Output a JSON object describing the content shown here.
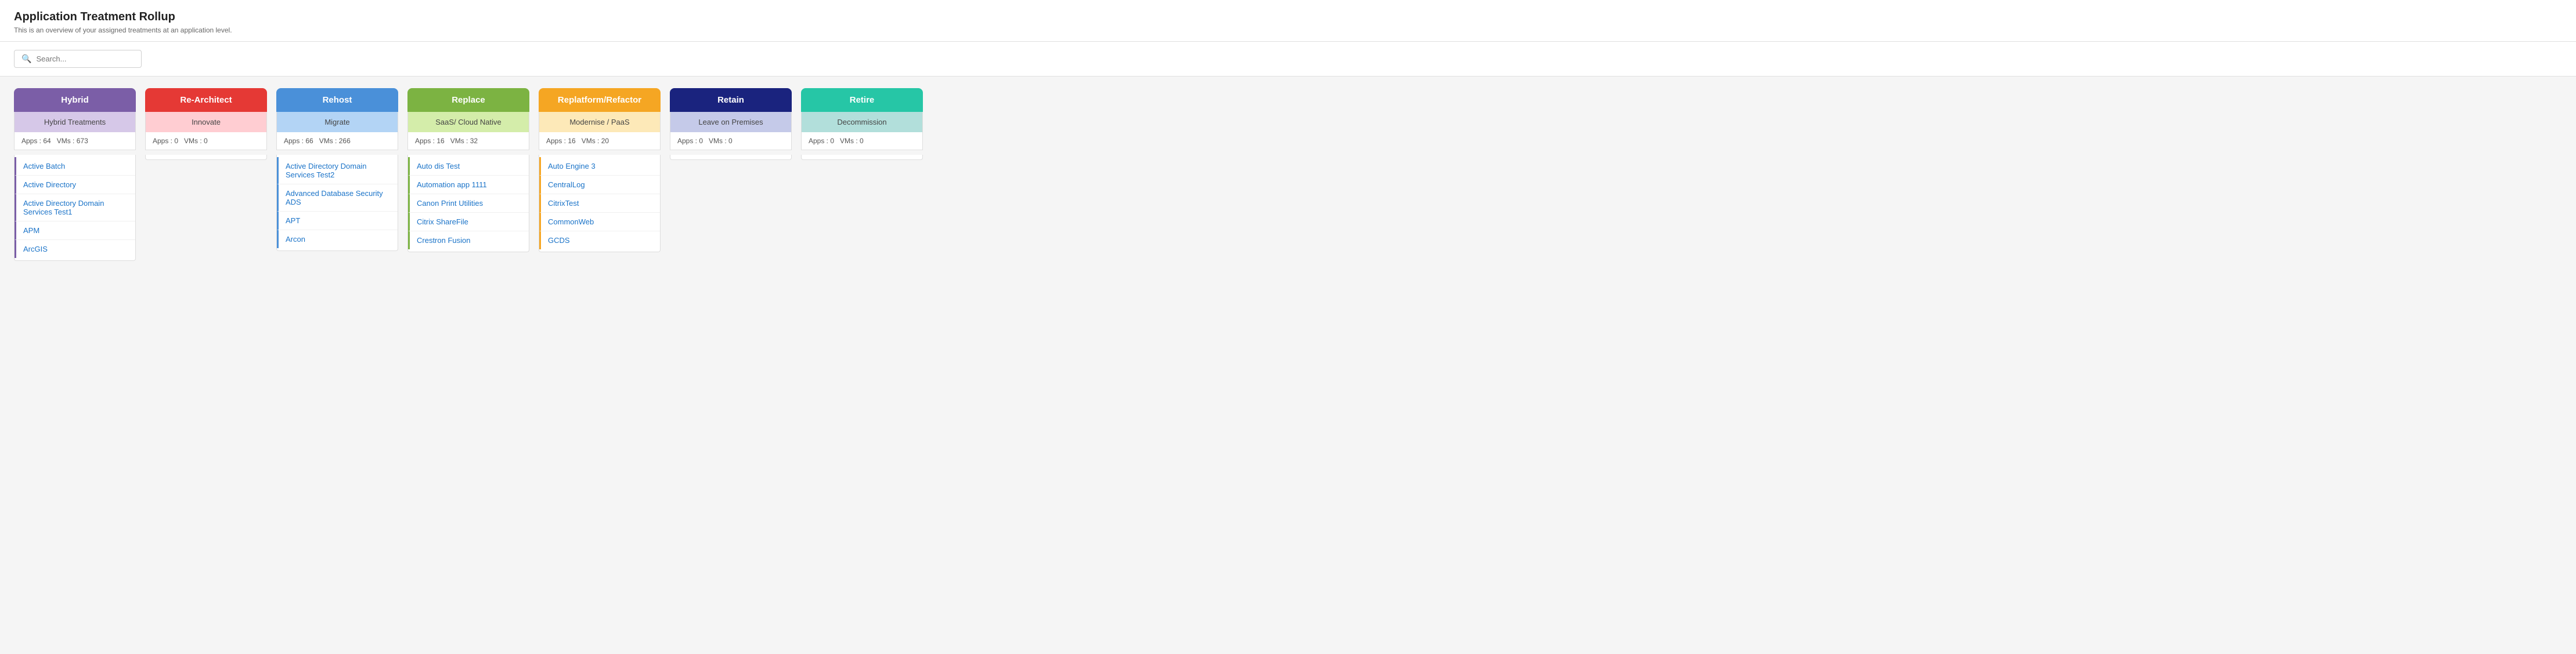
{
  "header": {
    "title": "Application Treatment Rollup",
    "subtitle": "This is an overview of your assigned treatments at an application level."
  },
  "search": {
    "placeholder": "Search..."
  },
  "columns": [
    {
      "id": "hybrid",
      "label": "Hybrid",
      "subLabel": "Hybrid Treatments",
      "headerClass": "bg-hybrid",
      "subClass": "bg-hybrid-sub",
      "colClass": "col-hybrid",
      "apps": 64,
      "vms": 673,
      "items": [
        "Active Batch",
        "Active Directory",
        "Active Directory Domain Services Test1",
        "APM",
        "ArcGIS"
      ]
    },
    {
      "id": "rearchitect",
      "label": "Re-Architect",
      "subLabel": "Innovate",
      "headerClass": "bg-rearchitect",
      "subClass": "bg-rearchitect-sub",
      "colClass": "col-rearchitect",
      "apps": 0,
      "vms": 0,
      "items": []
    },
    {
      "id": "rehost",
      "label": "Rehost",
      "subLabel": "Migrate",
      "headerClass": "bg-rehost",
      "subClass": "bg-rehost-sub",
      "colClass": "col-rehost",
      "apps": 66,
      "vms": 266,
      "items": [
        "Active Directory Domain Services Test2",
        "Advanced Database Security ADS",
        "APT",
        "Arcon"
      ]
    },
    {
      "id": "replace",
      "label": "Replace",
      "subLabel": "SaaS/ Cloud Native",
      "headerClass": "bg-replace",
      "subClass": "bg-replace-sub",
      "colClass": "col-replace",
      "apps": 16,
      "vms": 32,
      "items": [
        "Auto dis Test",
        "Automation app 1111",
        "Canon Print Utilities",
        "Citrix ShareFile",
        "Crestron Fusion"
      ]
    },
    {
      "id": "replatform",
      "label": "Replatform/Refactor",
      "subLabel": "Modernise / PaaS",
      "headerClass": "bg-replatform",
      "subClass": "bg-replatform-sub",
      "colClass": "col-replatform",
      "apps": 16,
      "vms": 20,
      "items": [
        "Auto Engine 3",
        "CentralLog",
        "CitrixTest",
        "CommonWeb",
        "GCDS"
      ]
    },
    {
      "id": "retain",
      "label": "Retain",
      "subLabel": "Leave on Premises",
      "headerClass": "bg-retain",
      "subClass": "bg-retain-sub",
      "colClass": "col-retain",
      "apps": 0,
      "vms": 0,
      "items": []
    },
    {
      "id": "retire",
      "label": "Retire",
      "subLabel": "Decommission",
      "headerClass": "bg-retire",
      "subClass": "bg-retire-sub",
      "colClass": "col-retire",
      "apps": 0,
      "vms": 0,
      "items": []
    }
  ],
  "labels": {
    "apps": "Apps :",
    "vms": "VMs :"
  }
}
